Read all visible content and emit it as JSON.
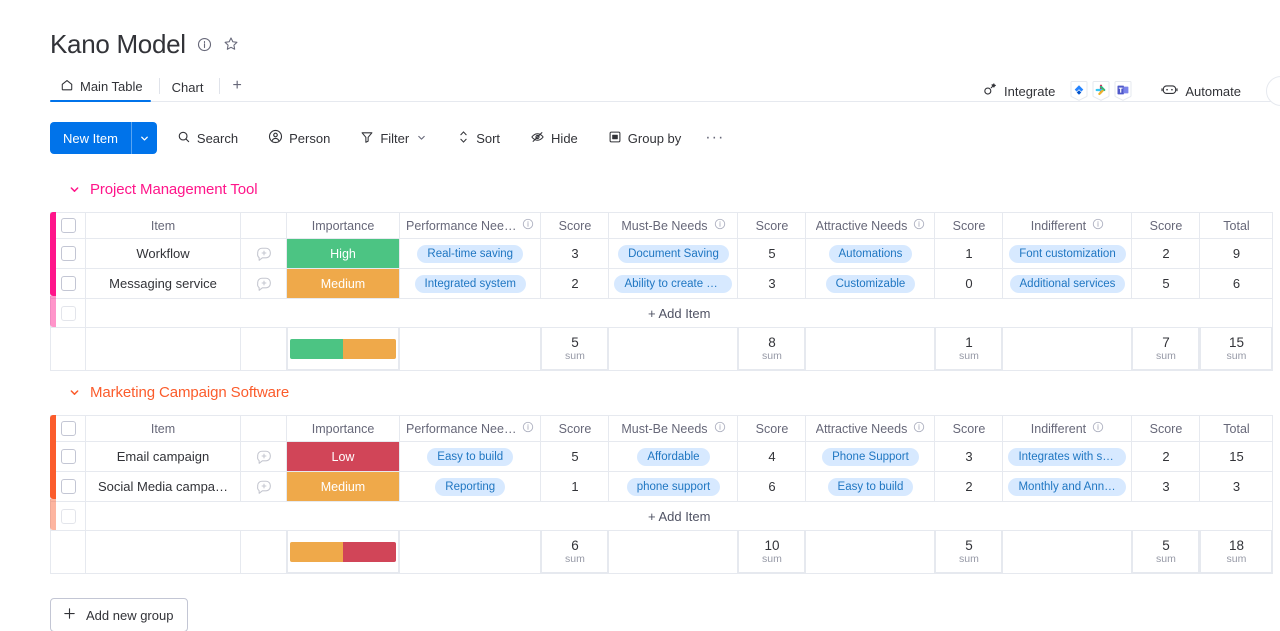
{
  "header": {
    "title": "Kano Model",
    "info_icon": "info-icon",
    "favorite_icon": "star-icon",
    "tabs": [
      {
        "label": "Main Table",
        "icon": "home-icon",
        "active": true
      },
      {
        "label": "Chart",
        "icon": "",
        "active": false
      }
    ],
    "add_tab_label": "+",
    "integrate_label": "Integrate",
    "automate_label": "Automate"
  },
  "toolbar": {
    "new_item_label": "New Item",
    "search_label": "Search",
    "person_label": "Person",
    "filter_label": "Filter",
    "sort_label": "Sort",
    "hide_label": "Hide",
    "group_by_label": "Group by",
    "more_label": "···"
  },
  "columns": [
    {
      "key": "item",
      "label": "Item",
      "info": false
    },
    {
      "key": "importance",
      "label": "Importance",
      "info": false
    },
    {
      "key": "performance",
      "label": "Performance Nee…",
      "info": true
    },
    {
      "key": "score1",
      "label": "Score",
      "info": false
    },
    {
      "key": "mustbe",
      "label": "Must-Be Needs",
      "info": true
    },
    {
      "key": "score2",
      "label": "Score",
      "info": false
    },
    {
      "key": "attractive",
      "label": "Attractive Needs",
      "info": true
    },
    {
      "key": "score3",
      "label": "Score",
      "info": false
    },
    {
      "key": "indifferent",
      "label": "Indifferent",
      "info": true
    },
    {
      "key": "score4",
      "label": "Score",
      "info": false
    },
    {
      "key": "total",
      "label": "Total",
      "info": false
    }
  ],
  "add_item_label": "+ Add Item",
  "sum_label": "sum",
  "add_new_group_label": "Add new group",
  "colors": {
    "accent_blue": "#0073ea",
    "group1": "#ff158a",
    "group2": "#fb5c2c",
    "high_green": "#4cc483",
    "medium_orange": "#efa94a",
    "low_red": "#d14558",
    "pill_bg": "#d7e9ff",
    "pill_text": "#1f76c2"
  },
  "groups": [
    {
      "name": "Project Management Tool",
      "color": "#ff158a",
      "rows": [
        {
          "item": "Workflow",
          "importance": {
            "label": "High",
            "color": "#4cc483"
          },
          "performance": "Real-time saving",
          "score1": "3",
          "mustbe": "Document Saving",
          "score2": "5",
          "attractive": "Automations",
          "score3": "1",
          "indifferent": "Font customization",
          "score4": "2",
          "total": "9"
        },
        {
          "item": "Messaging service",
          "importance": {
            "label": "Medium",
            "color": "#efa94a"
          },
          "performance": "Integrated system",
          "score1": "2",
          "mustbe": "Ability to create chan…",
          "score2": "3",
          "attractive": "Customizable",
          "score3": "0",
          "indifferent": "Additional services",
          "score4": "5",
          "total": "6"
        }
      ],
      "summary": {
        "battery": [
          {
            "color": "#4cc483",
            "pct": 50
          },
          {
            "color": "#efa94a",
            "pct": 50
          }
        ],
        "score1": "5",
        "score2": "8",
        "score3": "1",
        "score4": "7",
        "total": "15"
      }
    },
    {
      "name": "Marketing Campaign Software",
      "color": "#fb5c2c",
      "rows": [
        {
          "item": "Email campaign",
          "importance": {
            "label": "Low",
            "color": "#d14558"
          },
          "performance": "Easy to build",
          "score1": "5",
          "mustbe": "Affordable",
          "score2": "4",
          "attractive": "Phone Support",
          "score3": "3",
          "indifferent": "Integrates with softwar…",
          "score4": "2",
          "total": "15"
        },
        {
          "item": "Social Media campa…",
          "importance": {
            "label": "Medium",
            "color": "#efa94a"
          },
          "performance": "Reporting",
          "score1": "1",
          "mustbe": "phone support",
          "score2": "6",
          "attractive": "Easy to build",
          "score3": "2",
          "indifferent": "Monthly and Annual pla…",
          "score4": "3",
          "total": "3"
        }
      ],
      "summary": {
        "battery": [
          {
            "color": "#efa94a",
            "pct": 50
          },
          {
            "color": "#d14558",
            "pct": 50
          }
        ],
        "score1": "6",
        "score2": "10",
        "score3": "5",
        "score4": "5",
        "total": "18"
      }
    }
  ]
}
